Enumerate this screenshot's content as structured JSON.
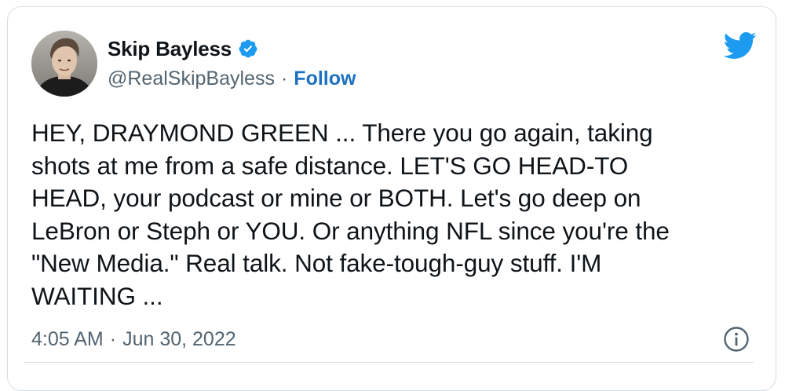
{
  "author": {
    "name": "Skip Bayless",
    "handle": "@RealSkipBayless",
    "separator": "·",
    "follow_label": "Follow"
  },
  "tweet": {
    "text": "HEY, DRAYMOND GREEN ... There you go again, taking\nshots at me from a safe distance. LET'S GO HEAD-TO\nHEAD, your podcast or mine or BOTH. Let's go deep on\nLeBron or Steph or YOU. Or anything NFL since you're the\n\"New Media.\" Real talk. Not fake-tough-guy stuff. I'M\nWAITING ...",
    "time": "4:05 AM",
    "separator": "·",
    "date": "Jun 30, 2022"
  },
  "icons": {
    "verified": "verified-badge-icon",
    "brand": "twitter-bird-icon",
    "info": "info-icon",
    "avatar": "avatar"
  },
  "colors": {
    "brand_blue": "#1d9bf0",
    "follow_blue": "#1d70c2",
    "secondary_text": "#536471",
    "primary_text": "#0f1419",
    "border": "#d6dde3"
  }
}
